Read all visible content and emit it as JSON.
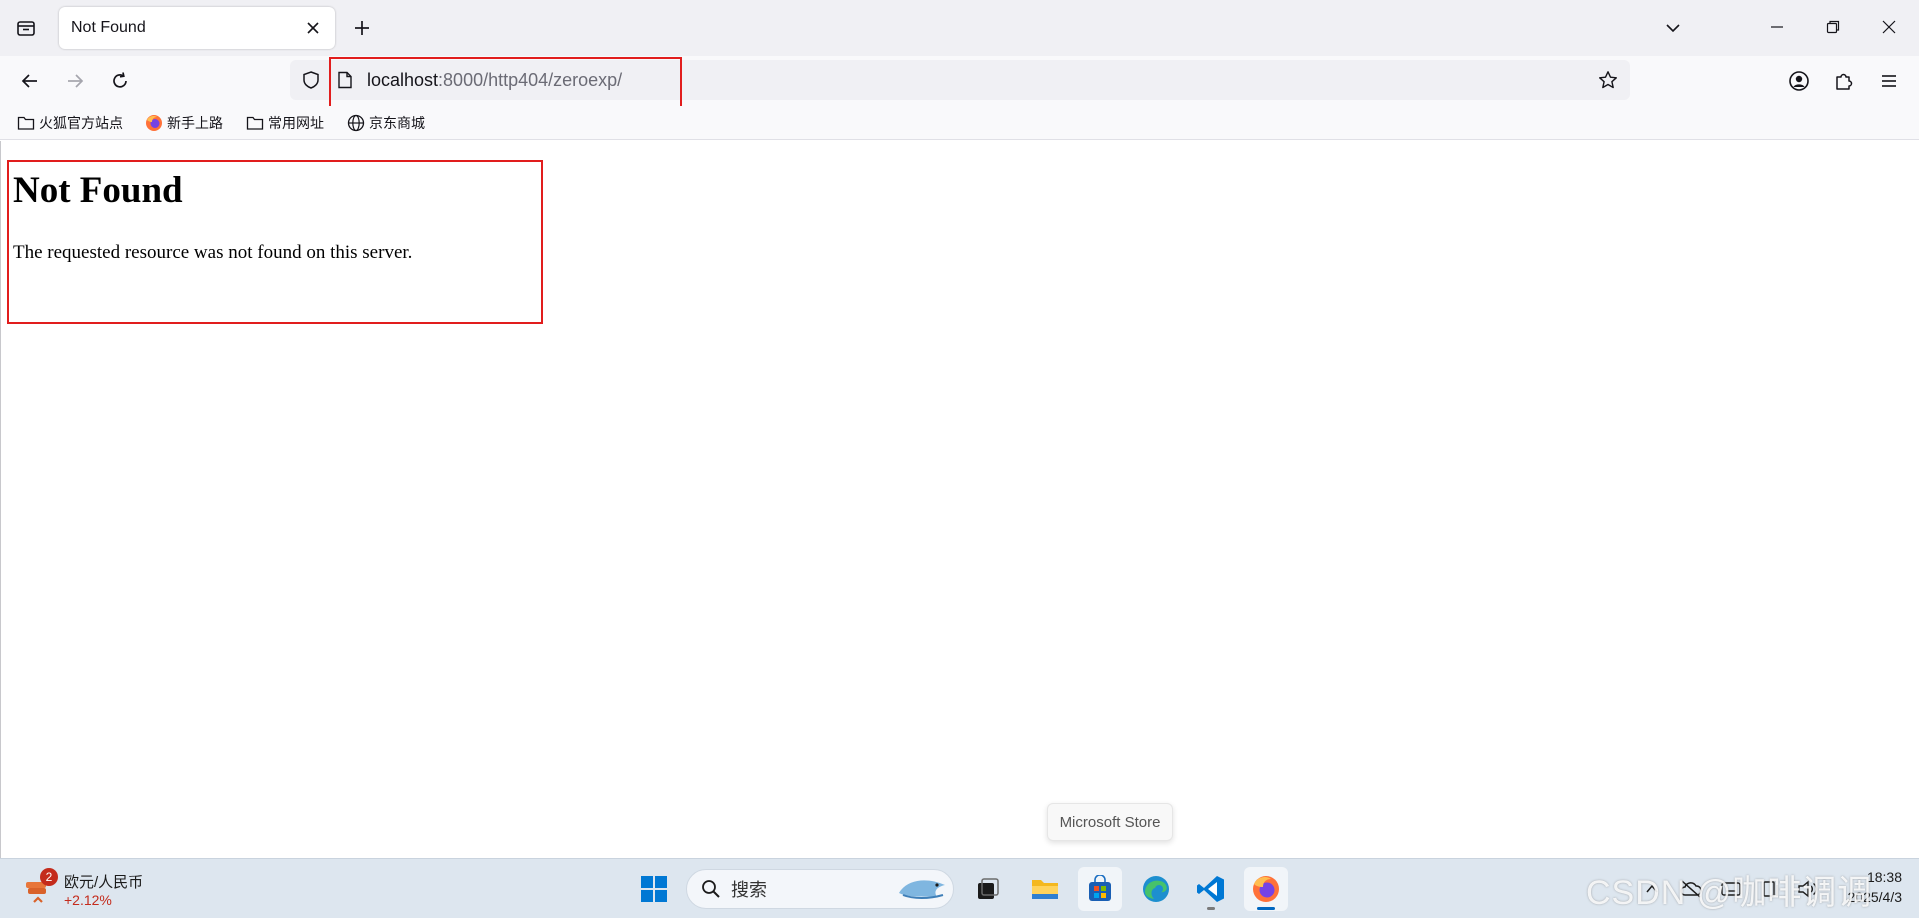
{
  "browser": {
    "tab": {
      "title": "Not Found"
    },
    "url": {
      "host": "localhost",
      "path": ":8000/http404/zeroexp/"
    },
    "bookmarks": [
      {
        "label": "火狐官方站点",
        "icon": "folder-icon"
      },
      {
        "label": "新手上路",
        "icon": "firefox-icon"
      },
      {
        "label": "常用网址",
        "icon": "folder-icon"
      },
      {
        "label": "京东商城",
        "icon": "globe-icon"
      }
    ]
  },
  "page": {
    "heading": "Not Found",
    "message": "The requested resource was not found on this server."
  },
  "tooltip": {
    "text": "Microsoft Store"
  },
  "taskbar": {
    "widget": {
      "badge": "2",
      "title": "欧元/人民币",
      "change": "+2.12%"
    },
    "search": {
      "label": "搜索"
    },
    "clock": {
      "time": "18:38",
      "date": "2025/4/3"
    }
  },
  "watermark": {
    "text": "CSDN @咖啡调调"
  },
  "colors": {
    "highlight": "#e11d1d",
    "tabstrip": "#f0f0f4",
    "navbar": "#f9f9fb",
    "taskbar": "#dde6ef",
    "accent": "#0067c0",
    "negative_change": "#c42b1c"
  }
}
